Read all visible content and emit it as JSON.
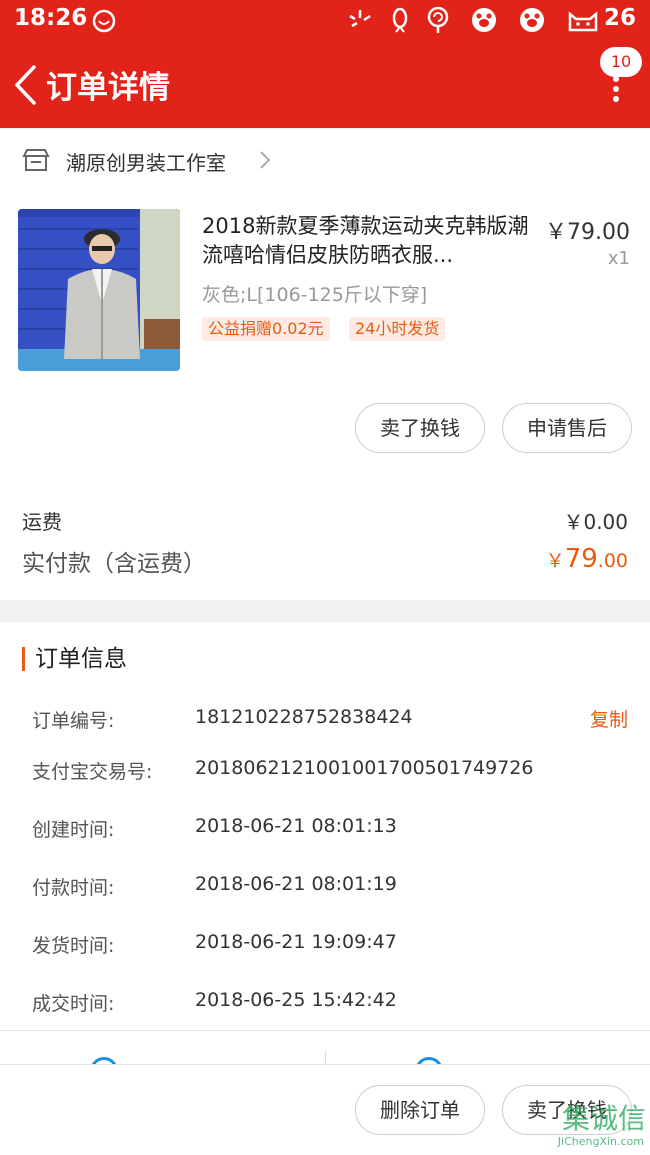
{
  "status_bar": {
    "time": "18:26",
    "battery": "26"
  },
  "nav": {
    "title": "订单详情",
    "badge": "10"
  },
  "shop": {
    "name": "潮原创男装工作室"
  },
  "item": {
    "title": "2018新款夏季薄款运动夹克韩版潮流嘻哈情侣皮肤防晒衣服...",
    "sku": "灰色;L[106-125斤以下穿]",
    "tags": [
      "公益捐赠0.02元",
      "24小时发货"
    ],
    "price": "￥79.00",
    "qty": "x1"
  },
  "item_actions": {
    "sell_label": "卖了换钱",
    "aftersale_label": "申请售后"
  },
  "fees": {
    "shipping_label": "运费",
    "shipping_value": "￥0.00",
    "total_label": "实付款（含运费）",
    "total_yen": "￥",
    "total_int": "79",
    "total_dec": ".00"
  },
  "order_info": {
    "title": "订单信息",
    "copy_label": "复制",
    "rows": [
      {
        "label": "订单编号:",
        "value": "181210228752838424"
      },
      {
        "label": "支付宝交易号:",
        "value": "2018062121001001700501749726"
      },
      {
        "label": "创建时间:",
        "value": "2018-06-21 08:01:13"
      },
      {
        "label": "付款时间:",
        "value": "2018-06-21 08:01:19"
      },
      {
        "label": "发货时间:",
        "value": "2018-06-21 19:09:47"
      },
      {
        "label": "成交时间:",
        "value": "2018-06-25 15:42:42"
      }
    ]
  },
  "bottom_actions": {
    "delete_label": "删除订单",
    "sell_label": "卖了换钱"
  },
  "watermark": {
    "cn": "集诚信",
    "en": "JiChengXin.com"
  },
  "colors": {
    "brand_red": "#e2231a",
    "accent_orange": "#ec5a12",
    "link_blue": "#1a8ee0"
  }
}
